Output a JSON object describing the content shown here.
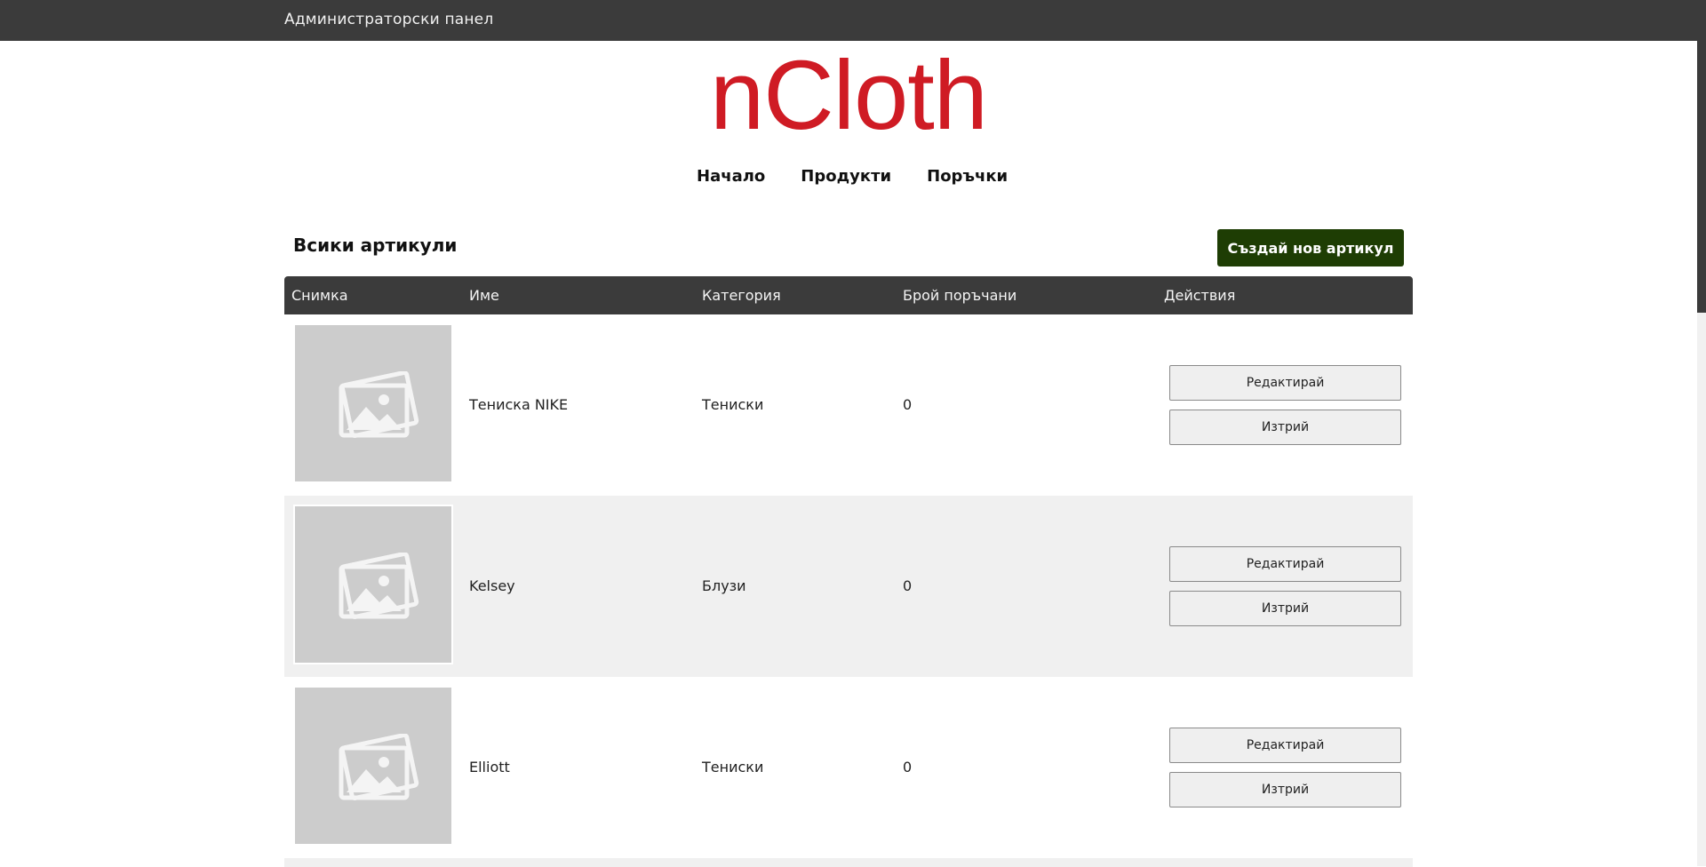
{
  "topbar": {
    "title": "Администраторски панел"
  },
  "logo": {
    "text": "nCloth",
    "color": "#cf1b24"
  },
  "nav": {
    "items": [
      {
        "label": "Начало"
      },
      {
        "label": "Продукти"
      },
      {
        "label": "Поръчки"
      }
    ]
  },
  "section": {
    "title": "Всики артикули",
    "create_label": "Създай нов артикул"
  },
  "table": {
    "columns": [
      "Снимка",
      "Име",
      "Категория",
      "Брой поръчани",
      "Действия"
    ],
    "rows": [
      {
        "name": "Тениска NIKE",
        "category": "Тениски",
        "ordered": "0",
        "edit_label": "Редактирай",
        "delete_label": "Изтрий"
      },
      {
        "name": "Kelsey",
        "category": "Блузи",
        "ordered": "0",
        "edit_label": "Редактирай",
        "delete_label": "Изтрий"
      },
      {
        "name": "Elliott",
        "category": "Тениски",
        "ordered": "0",
        "edit_label": "Редактирай",
        "delete_label": "Изтрий"
      }
    ]
  },
  "colors": {
    "topbar": "#3b3b3b",
    "accent_red": "#cf1b24",
    "create_button": "#1e3d04",
    "row_alt": "#f0f0f0",
    "thumb_placeholder": "#cccccc"
  }
}
